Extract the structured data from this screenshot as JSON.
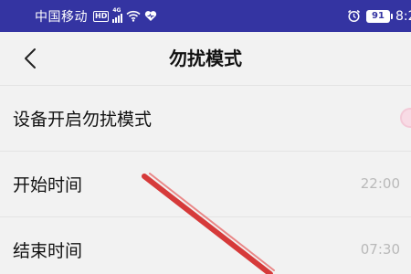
{
  "status_bar": {
    "carrier": "中国移动",
    "hd_badge": "HD",
    "network": "4G",
    "battery": "91",
    "time": "8:2",
    "icons": [
      "hd-icon",
      "signal-icon",
      "wifi-icon",
      "heart-icon",
      "alarm-icon",
      "battery-icon"
    ],
    "bg_color": "#3434a2"
  },
  "header": {
    "title": "勿扰模式",
    "back_icon": "chevron-left-icon"
  },
  "settings": {
    "dnd": {
      "label": "设备开启勿扰模式",
      "toggle_on": false,
      "toggle_color": "#f3c9d7"
    },
    "start": {
      "label": "开始时间",
      "value": "22:00"
    },
    "end": {
      "label": "结束时间",
      "value": "07:30"
    }
  },
  "annotation": {
    "type": "arrow",
    "color": "#d63a3a"
  }
}
